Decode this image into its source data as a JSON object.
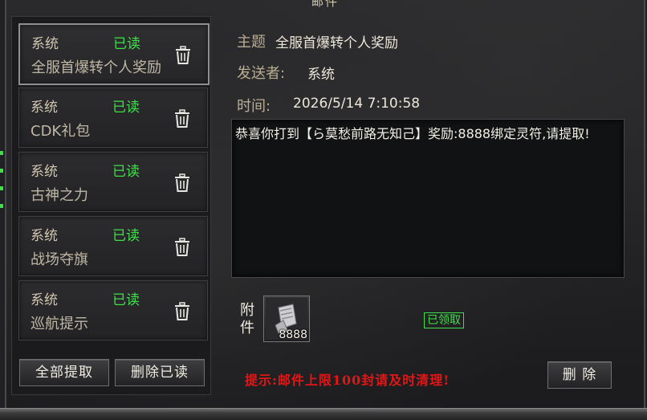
{
  "window": {
    "title": "邮件"
  },
  "mail_list": [
    {
      "sender": "系统",
      "status": "已读",
      "subject": "全服首爆转个人奖励",
      "selected": true
    },
    {
      "sender": "系统",
      "status": "已读",
      "subject": "CDK礼包"
    },
    {
      "sender": "系统",
      "status": "已读",
      "subject": "古神之力"
    },
    {
      "sender": "系统",
      "status": "已读",
      "subject": "战场夺旗"
    },
    {
      "sender": "系统",
      "status": "已读",
      "subject": "巡航提示"
    }
  ],
  "buttons": {
    "claim_all": "全部提取",
    "delete_read": "删除已读",
    "delete": "删 除"
  },
  "detail": {
    "subject_label": "主题",
    "subject_value": "全服首爆转个人奖励",
    "sender_label": "发送者:",
    "sender_value": "系统",
    "time_label": "时间:",
    "time_value": "2026/5/14 7:10:58",
    "content": "恭喜你打到【ら莫愁前路无知己】奖励:8888绑定灵符,请提取!",
    "attachment_label": "附件",
    "attachment_count": "8888",
    "attachment_status": "已领取"
  },
  "tip": "提示:邮件上限100封请及时清理!",
  "colors": {
    "status_green": "#3ee04a",
    "tip_red": "#e21616"
  },
  "icons": {
    "delete": "trash-icon",
    "attachment": "scroll-item-icon"
  }
}
